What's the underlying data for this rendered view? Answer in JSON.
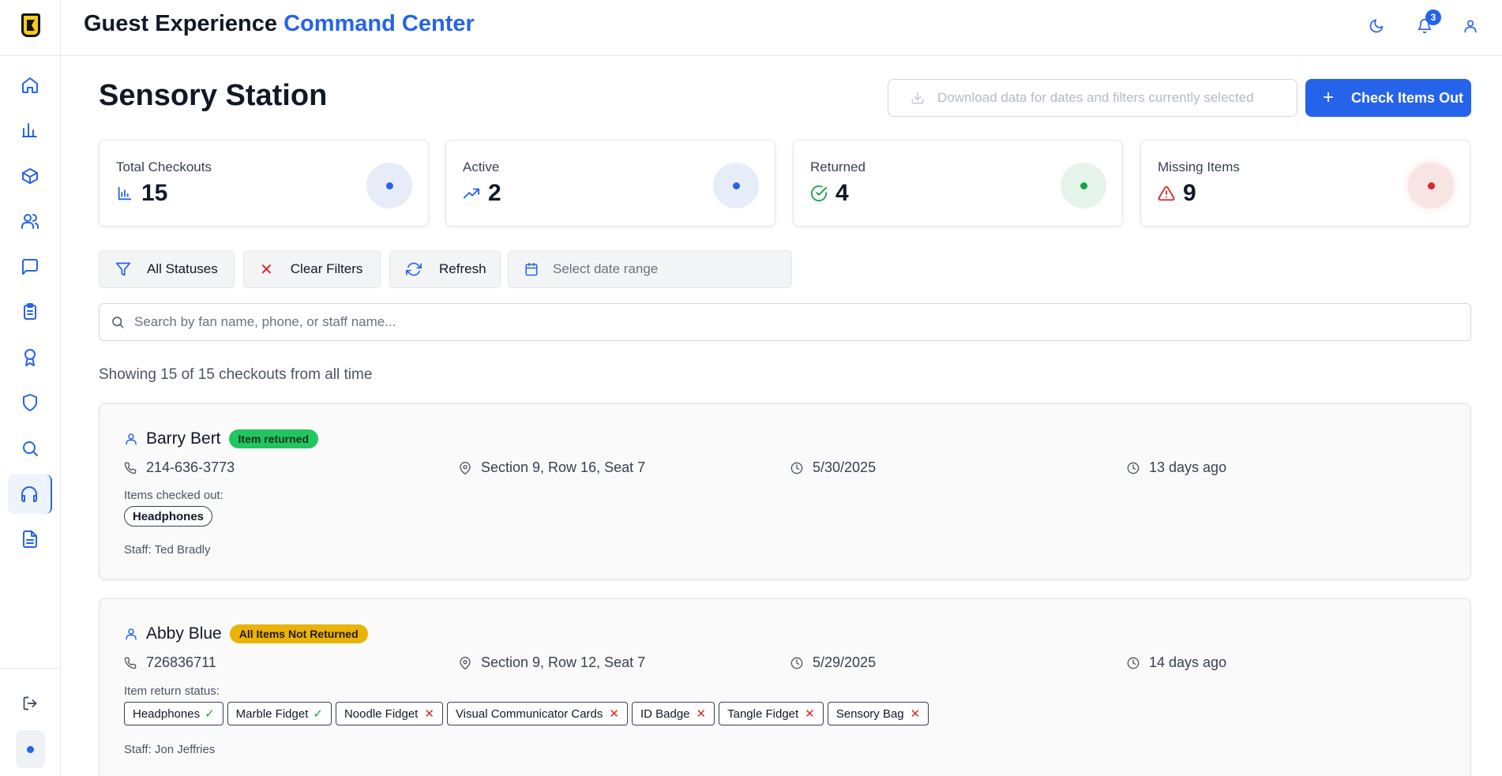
{
  "header": {
    "title_main": "Guest Experience",
    "title_accent": "Command Center",
    "notification_count": "3"
  },
  "sidebar": {
    "items": [
      {
        "name": "home-icon"
      },
      {
        "name": "bar-chart-icon"
      },
      {
        "name": "box-icon"
      },
      {
        "name": "users-icon"
      },
      {
        "name": "message-icon"
      },
      {
        "name": "clipboard-icon"
      },
      {
        "name": "award-icon"
      },
      {
        "name": "shield-icon"
      },
      {
        "name": "search-icon"
      },
      {
        "name": "headphones-icon",
        "active": true
      },
      {
        "name": "file-icon"
      }
    ]
  },
  "page": {
    "title": "Sensory Station",
    "download_label": "Download data for dates and filters currently selected",
    "checkout_label": "Check Items Out"
  },
  "stats": [
    {
      "label": "Total Checkouts",
      "value": "15",
      "color": "#2563eb"
    },
    {
      "label": "Active",
      "value": "2",
      "color": "#2563eb"
    },
    {
      "label": "Returned",
      "value": "4",
      "color": "#16a34a"
    },
    {
      "label": "Missing Items",
      "value": "9",
      "color": "#dc2626"
    }
  ],
  "filters": {
    "status_label": "All Statuses",
    "clear_label": "Clear Filters",
    "refresh_label": "Refresh",
    "date_placeholder": "Select date range",
    "search_placeholder": "Search by fan name, phone, or staff name..."
  },
  "showing_text": "Showing 15 of 15 checkouts from all time",
  "checkouts": [
    {
      "name": "Barry Bert",
      "status": "Item returned",
      "phone": "214-636-3773",
      "location": "Section 9, Row 16, Seat 7",
      "date": "5/30/2025",
      "ago": "13 days ago",
      "items_label": "Items checked out:",
      "items": [
        "Headphones"
      ],
      "staff": "Staff: Ted Bradly"
    },
    {
      "name": "Abby Blue",
      "status": "All Items Not Returned",
      "phone": "726836711",
      "location": "Section 9, Row 12, Seat 7",
      "date": "5/29/2025",
      "ago": "14 days ago",
      "items_label": "Item return status:",
      "items": [
        {
          "name": "Headphones",
          "returned": true,
          "mark": "✓"
        },
        {
          "name": "Marble Fidget",
          "returned": true,
          "mark": "✓"
        },
        {
          "name": "Noodle Fidget",
          "returned": false,
          "mark": "✕"
        },
        {
          "name": "Visual Communicator Cards",
          "returned": false,
          "mark": "✕"
        },
        {
          "name": "ID Badge",
          "returned": false,
          "mark": "✕"
        },
        {
          "name": "Tangle Fidget",
          "returned": false,
          "mark": "✕"
        },
        {
          "name": "Sensory Bag",
          "returned": false,
          "mark": "✕"
        }
      ],
      "staff": "Staff: Jon Jeffries"
    }
  ]
}
